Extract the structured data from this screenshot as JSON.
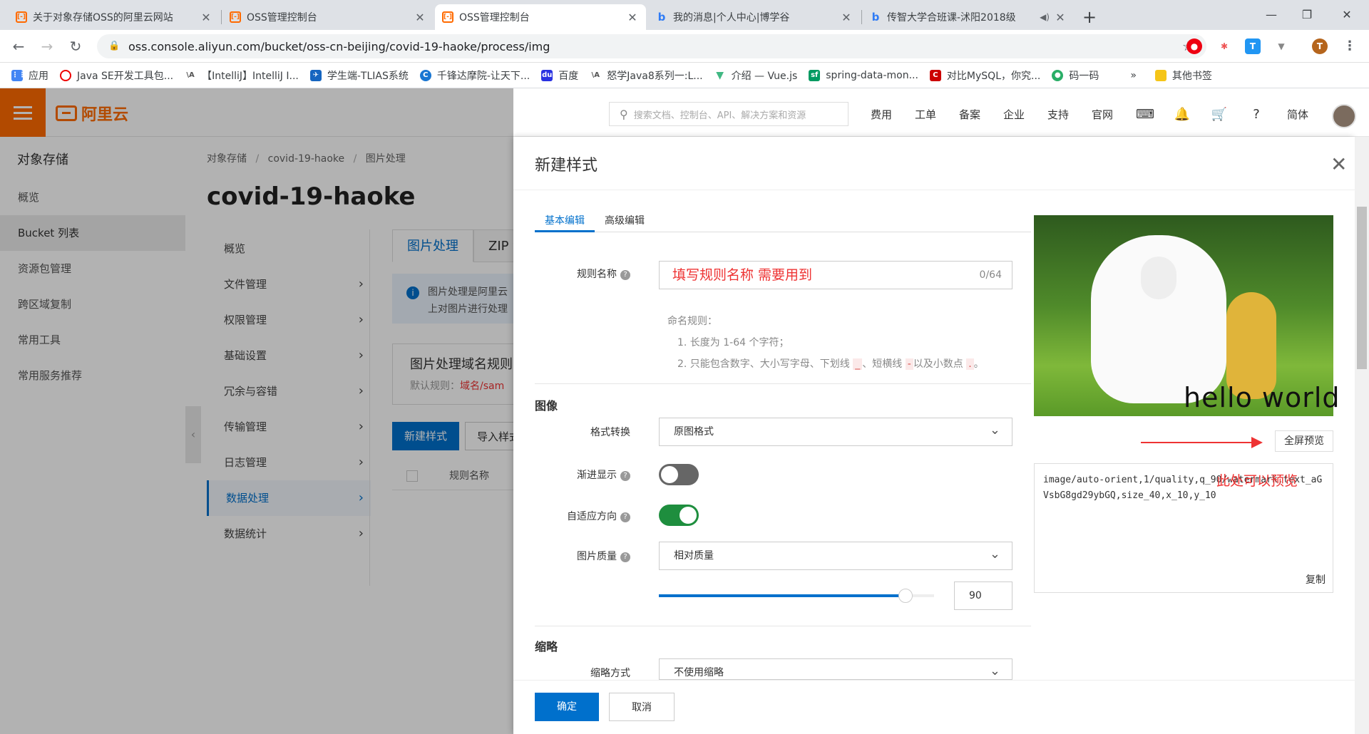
{
  "browser": {
    "tabs": [
      {
        "title": "关于对象存储OSS的阿里云网站"
      },
      {
        "title": "OSS管理控制台"
      },
      {
        "title": "OSS管理控制台"
      },
      {
        "title": "我的消息|个人中心|博学谷"
      },
      {
        "title": "传智大学合班课-沭阳2018级"
      }
    ],
    "url": "oss.console.aliyun.com/bucket/oss-cn-beijing/covid-19-haoke/process/img",
    "profile_initial": "T",
    "bookmarks": [
      {
        "label": "应用",
        "icon": "apps-grid-icon"
      },
      {
        "label": "Java SE开发工具包...",
        "icon": "oracle-icon"
      },
      {
        "label": "【IntelliJ】IntelliJ I...",
        "icon": "intellij-icon"
      },
      {
        "label": "学生端-TLIAS系统",
        "icon": "tlias-icon"
      },
      {
        "label": "千锋达摩院-让天下...",
        "icon": "qianfeng-icon"
      },
      {
        "label": "百度",
        "icon": "baidu-icon"
      },
      {
        "label": "怒学Java8系列一:L...",
        "icon": "bookmark-icon"
      },
      {
        "label": "介绍 — Vue.js",
        "icon": "vue-icon"
      },
      {
        "label": "spring-data-mon...",
        "icon": "sf-icon"
      },
      {
        "label": "对比MySQL，你究...",
        "icon": "csdn-icon"
      },
      {
        "label": "码一码",
        "icon": "wechat-icon"
      }
    ],
    "bookmarks_more": "»",
    "other_bookmarks": "其他书签"
  },
  "console": {
    "logo": "阿里云",
    "search_placeholder": "搜索文档、控制台、API、解决方案和资源",
    "nav": [
      "费用",
      "工单",
      "备案",
      "企业",
      "支持",
      "官网"
    ],
    "lang": "简体"
  },
  "sidebar": {
    "title": "对象存储",
    "items": [
      "概览",
      "Bucket 列表",
      "资源包管理",
      "跨区域复制",
      "常用工具",
      "常用服务推荐"
    ],
    "active": "Bucket 列表"
  },
  "bucket": {
    "breadcrumb": [
      "对象存储",
      "covid-19-haoke",
      "图片处理"
    ],
    "name": "covid-19-haoke",
    "subnav": [
      "概览",
      "文件管理",
      "权限管理",
      "基础设置",
      "冗余与容错",
      "传输管理",
      "日志管理",
      "数据处理",
      "数据统计"
    ],
    "tabs": [
      "图片处理",
      "ZIP 包"
    ],
    "info_line1": "图片处理是阿里云",
    "info_line2": "上对图片进行处理",
    "domain_title": "图片处理域名规则",
    "domain_desc_label": "默认规则：",
    "domain_desc_value": "域名/sam",
    "new_style_btn": "新建样式",
    "import_btn": "导入样式",
    "col_name": "规则名称"
  },
  "drawer": {
    "title": "新建样式",
    "tabs": [
      "基本编辑",
      "高级编辑"
    ],
    "rule_name_label": "规则名称",
    "rule_name_value": "填写规则名称 需要用到",
    "rule_name_count": "0/64",
    "naming_rules_title": "命名规则：",
    "naming_rule_1": "1. 长度为 1-64 个字符；",
    "naming_rule_2_pre": "2. 只能包含数字、大小写字母、下划线",
    "naming_rule_2_sym1": "_",
    "naming_rule_2_mid": "、短横线",
    "naming_rule_2_sym2": "-",
    "naming_rule_2_mid2": "以及小数点",
    "naming_rule_2_sym3": ".",
    "naming_rule_2_end": "。",
    "section_image": "图像",
    "format_label": "格式转换",
    "format_value": "原图格式",
    "progressive_label": "渐进显示",
    "progressive_on": false,
    "auto_orient_label": "自适应方向",
    "auto_orient_on": true,
    "quality_label": "图片质量",
    "quality_mode": "相对质量",
    "quality_value": "90",
    "quality_fraction": 0.9,
    "section_thumb": "缩略",
    "thumb_label": "缩略方式",
    "thumb_value": "不使用缩略",
    "preview_watermark": "hello world",
    "fullscreen_btn": "全屏预览",
    "code": "image/auto-orient,1/quality,q_90/watermark,text_aGVsbG8gd29ybGQ,size_40,x_10,y_10",
    "annotation": "此处可以预览",
    "copy_btn": "复制",
    "ok_btn": "确定",
    "cancel_btn": "取消"
  }
}
